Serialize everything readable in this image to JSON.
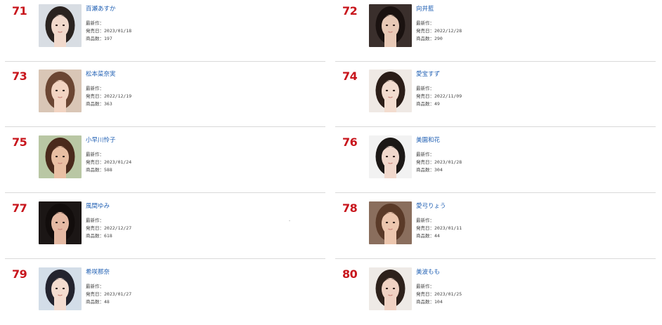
{
  "labels": {
    "latest": "最新作：",
    "release": "発売日：",
    "count": "商品数："
  },
  "entries": [
    {
      "rank": "71",
      "name": "百瀬あすか",
      "latest": "",
      "release_date": "2023/01/18",
      "product_count": "197",
      "photo_colors": {
        "bg": "#d8dde3",
        "hair": "#2a2320",
        "skin": "#f1d9cc"
      }
    },
    {
      "rank": "72",
      "name": "向井藍",
      "latest": "",
      "release_date": "2022/12/28",
      "product_count": "290",
      "photo_colors": {
        "bg": "#3a2f2c",
        "hair": "#1a1210",
        "skin": "#e8c9b6"
      }
    },
    {
      "rank": "73",
      "name": "松本菜奈実",
      "latest": "",
      "release_date": "2022/12/19",
      "product_count": "363",
      "photo_colors": {
        "bg": "#d9c6b6",
        "hair": "#6b4633",
        "skin": "#f2d4c2"
      }
    },
    {
      "rank": "74",
      "name": "愛宝すず",
      "latest": "",
      "release_date": "2022/11/09",
      "product_count": "49",
      "photo_colors": {
        "bg": "#efe9e4",
        "hair": "#2b1d17",
        "skin": "#f3dccf"
      }
    },
    {
      "rank": "75",
      "name": "小早川怜子",
      "latest": "",
      "release_date": "2023/01/24",
      "product_count": "588",
      "photo_colors": {
        "bg": "#b9c7a4",
        "hair": "#4a2a1c",
        "skin": "#e9bfa3"
      }
    },
    {
      "rank": "76",
      "name": "美園和花",
      "latest": "",
      "release_date": "2023/01/28",
      "product_count": "304",
      "photo_colors": {
        "bg": "#f2f2f2",
        "hair": "#1c1816",
        "skin": "#f1d8cc"
      }
    },
    {
      "rank": "77",
      "name": "風間ゆみ",
      "latest": "",
      "release_date": "2022/12/27",
      "product_count": "618",
      "photo_colors": {
        "bg": "#1b1615",
        "hair": "#120d0c",
        "skin": "#e4b9a3"
      }
    },
    {
      "rank": "78",
      "name": "愛弓りょう",
      "latest": "",
      "release_date": "2023/01/11",
      "product_count": "44",
      "photo_colors": {
        "bg": "#8a6e5d",
        "hair": "#5a3a28",
        "skin": "#ecc6ae"
      }
    },
    {
      "rank": "79",
      "name": "希咲那奈",
      "latest": "",
      "release_date": "2023/01/27",
      "product_count": "48",
      "photo_colors": {
        "bg": "#d3dde8",
        "hair": "#23232e",
        "skin": "#f4dcd0"
      }
    },
    {
      "rank": "80",
      "name": "美波もも",
      "latest": "",
      "release_date": "2023/01/25",
      "product_count": "104",
      "photo_colors": {
        "bg": "#eeeae6",
        "hair": "#2d211b",
        "skin": "#f0d2c3"
      }
    }
  ]
}
